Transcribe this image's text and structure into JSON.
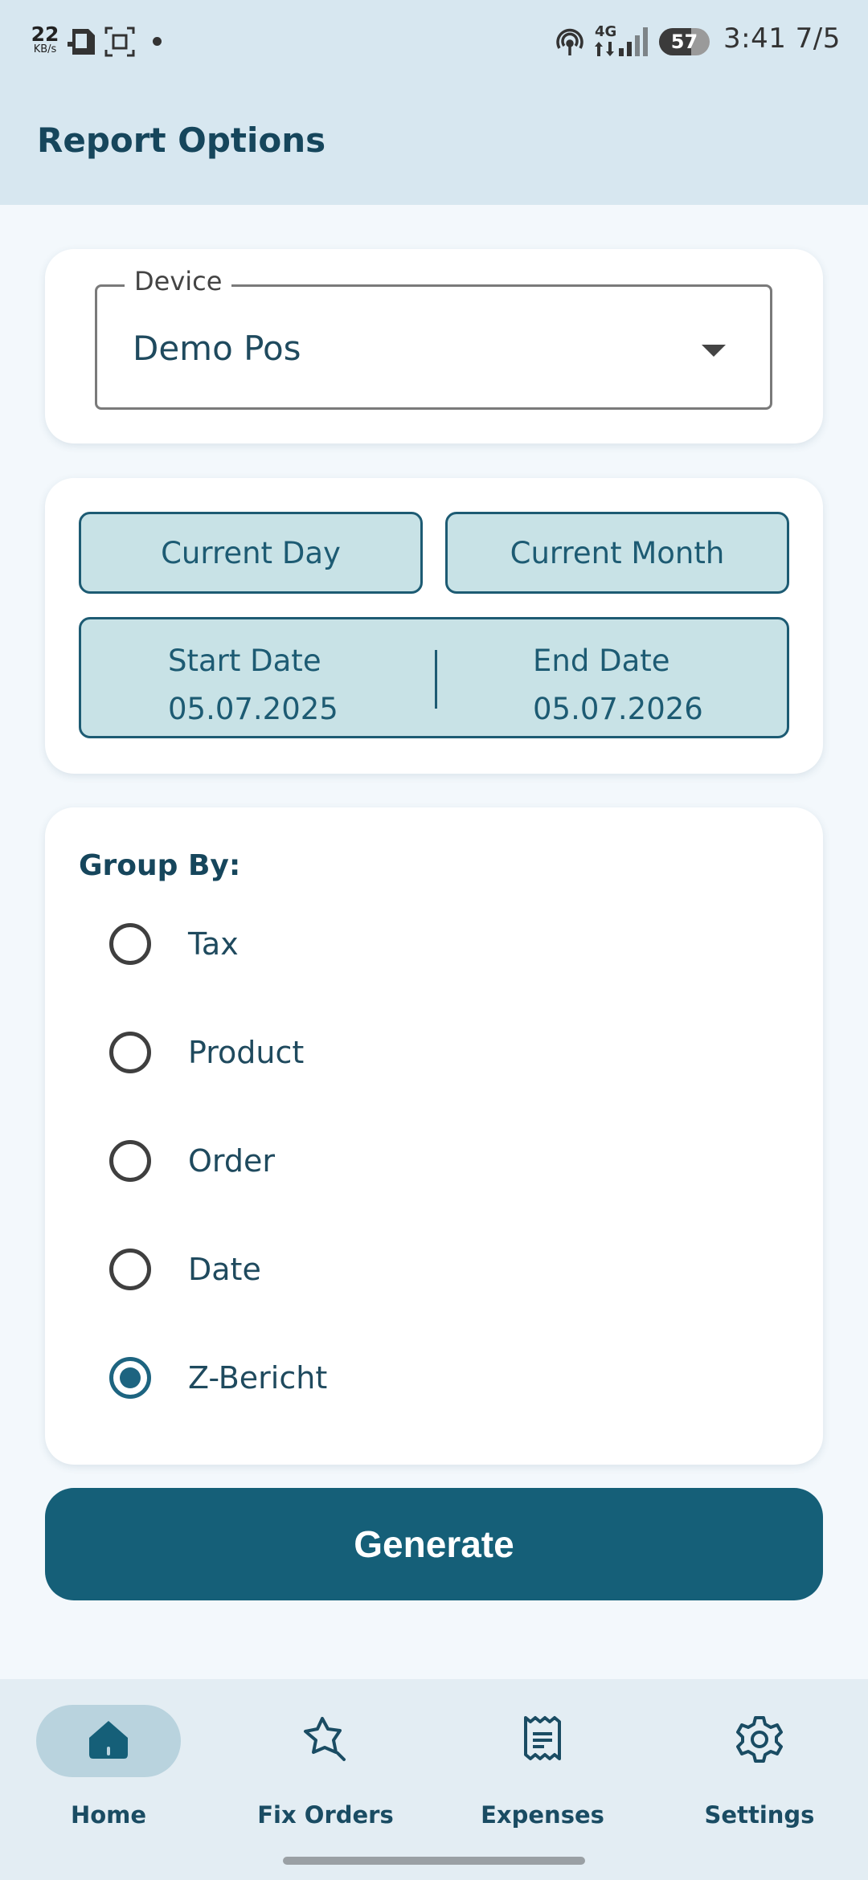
{
  "status_bar": {
    "net_speed": "22",
    "net_unit": "KB/s",
    "network": "4G",
    "battery": "57",
    "time": "3:41",
    "date": "7/5"
  },
  "header": {
    "title": "Report Options"
  },
  "device": {
    "label": "Device",
    "value": "Demo Pos"
  },
  "dates": {
    "current_day": "Current Day",
    "current_month": "Current Month",
    "start_label": "Start Date",
    "start_value": "05.07.2025",
    "end_label": "End Date",
    "end_value": "05.07.2026"
  },
  "group_by": {
    "title": "Group By:",
    "options": [
      {
        "label": "Tax",
        "selected": false
      },
      {
        "label": "Product",
        "selected": false
      },
      {
        "label": "Order",
        "selected": false
      },
      {
        "label": "Date",
        "selected": false
      },
      {
        "label": "Z-Bericht",
        "selected": true
      }
    ]
  },
  "actions": {
    "generate": "Generate"
  },
  "nav": {
    "items": [
      {
        "label": "Home",
        "icon": "home-icon",
        "active": true
      },
      {
        "label": "Fix Orders",
        "icon": "star-badge-icon",
        "active": false
      },
      {
        "label": "Expenses",
        "icon": "receipt-icon",
        "active": false
      },
      {
        "label": "Settings",
        "icon": "gear-icon",
        "active": false
      }
    ]
  },
  "colors": {
    "primary": "#155f78",
    "chip_bg": "#c8e2e6",
    "header_bg": "#d7e7f0",
    "page_bg": "#f3f8fc",
    "text": "#16465c"
  }
}
